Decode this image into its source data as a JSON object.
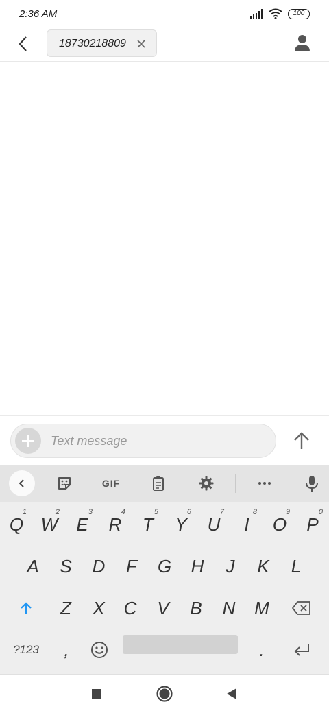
{
  "status_bar": {
    "time": "2:36 AM",
    "battery": "100"
  },
  "header": {
    "recipient": "18730218809"
  },
  "compose": {
    "placeholder": "Text message"
  },
  "keyboard": {
    "toolbar": {
      "gif_label": "GIF"
    },
    "row1": [
      {
        "char": "Q",
        "hint": "1"
      },
      {
        "char": "W",
        "hint": "2"
      },
      {
        "char": "E",
        "hint": "3"
      },
      {
        "char": "R",
        "hint": "4"
      },
      {
        "char": "T",
        "hint": "5"
      },
      {
        "char": "Y",
        "hint": "6"
      },
      {
        "char": "U",
        "hint": "7"
      },
      {
        "char": "I",
        "hint": "8"
      },
      {
        "char": "O",
        "hint": "9"
      },
      {
        "char": "P",
        "hint": "0"
      }
    ],
    "row2": [
      "A",
      "S",
      "D",
      "F",
      "G",
      "H",
      "J",
      "K",
      "L"
    ],
    "row3": [
      "Z",
      "X",
      "C",
      "V",
      "B",
      "N",
      "M"
    ],
    "symbols_label": "?123",
    "comma": ",",
    "period": "."
  },
  "colors": {
    "accent": "#2196F3",
    "keyboard_bg": "#eeeeee",
    "toolbar_bg": "#e4e4e4"
  }
}
